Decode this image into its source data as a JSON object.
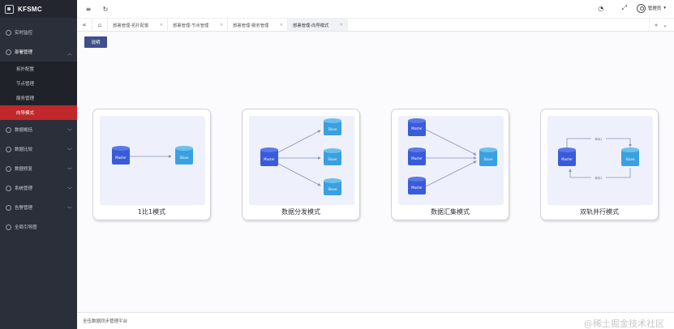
{
  "app": {
    "brand": "KFSMC"
  },
  "sidebar": {
    "items": [
      {
        "label": "实时监控",
        "expanded": false
      },
      {
        "label": "部署管理",
        "expanded": true,
        "children": [
          "拓扑配置",
          "节点管理",
          "服务管理",
          "向导模式"
        ],
        "active_child": "向导模式"
      },
      {
        "label": "数据概括"
      },
      {
        "label": "数据比较"
      },
      {
        "label": "数据修复"
      },
      {
        "label": "系统管理"
      },
      {
        "label": "告警管理"
      },
      {
        "label": "全局引导图"
      }
    ]
  },
  "topbar": {
    "user": "管理员"
  },
  "tabs": [
    {
      "label": "部署管理-拓扑配置",
      "active": false
    },
    {
      "label": "部署管理-节点管理",
      "active": false
    },
    {
      "label": "部署管理-服务管理",
      "active": false
    },
    {
      "label": "部署管理-向导模式",
      "active": true
    }
  ],
  "content": {
    "desc_button": "说明",
    "modes": [
      {
        "label": "1比1模式"
      },
      {
        "label": "数据分发模式"
      },
      {
        "label": "数据汇集模式"
      },
      {
        "label": "双轨并行模式"
      }
    ],
    "db": {
      "master": "Master",
      "slave": "Slave",
      "edge_forward": "单向1",
      "edge_back": "单向2"
    }
  },
  "footer": {
    "text": "全伍数据同步管理平台",
    "watermark": "@稀土掘金技术社区"
  },
  "colors": {
    "sidebar_bg": "#2b2f3a",
    "active_red": "#c0282b",
    "master_db": "#3a5bd9",
    "slave_db": "#3aa0e0",
    "button_bg": "#3e4f8c"
  }
}
